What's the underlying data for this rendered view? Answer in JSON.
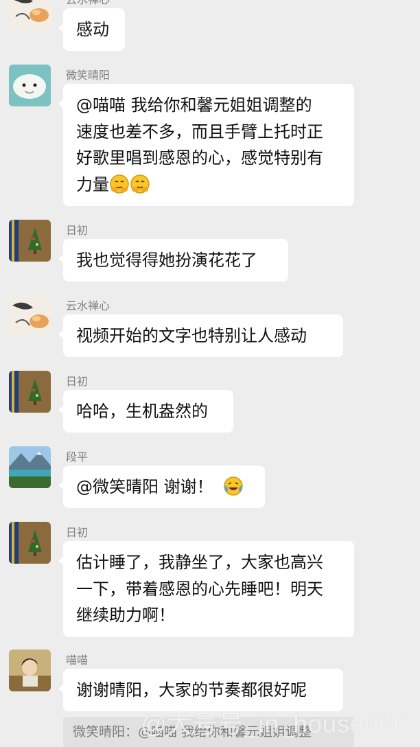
{
  "messages": [
    {
      "sender": "云水禅心",
      "avatar": "ink-painting-avatar",
      "text": "感动"
    },
    {
      "sender": "微笑晴阳",
      "avatar": "beluga-whale-avatar",
      "lines": [
        "@喵喵  我给你和馨元姐姐调整的",
        "速度也差不多，而且手臂上托时正",
        "好歌里唱到感恩的心，感觉特别有",
        "力量"
      ],
      "emoji": [
        "hugging-face-emoji",
        "hugging-face-emoji"
      ]
    },
    {
      "sender": "日初",
      "avatar": "christmas-tree-bag-avatar",
      "text": "我也觉得得她扮演花花了"
    },
    {
      "sender": "云水禅心",
      "avatar": "ink-painting-avatar",
      "text": "视频开始的文字也特别让人感动"
    },
    {
      "sender": "日初",
      "avatar": "christmas-tree-bag-avatar",
      "text": "哈哈，生机盎然的"
    },
    {
      "sender": "段平",
      "avatar": "mountain-lake-avatar",
      "text": "@微笑晴阳  谢谢！",
      "emoji": [
        "crying-laughing-emoji"
      ]
    },
    {
      "sender": "日初",
      "avatar": "christmas-tree-bag-avatar",
      "lines": [
        "估计睡了，我静坐了，大家也高兴",
        "一下，带着感恩的心先睡吧！明天",
        "继续助力啊！"
      ]
    },
    {
      "sender": "喵喵",
      "avatar": "girl-portrait-avatar",
      "text": "谢谢晴阳，大家的节奏都很好呢"
    }
  ],
  "quote": {
    "text": "微笑晴阳：@喵喵 我给你和馨元姐姐调整"
  },
  "watermark": {
    "text": "@大号号_in_house086"
  },
  "colors": {
    "background": "#ededed",
    "bubble": "#ffffff",
    "name": "#7f7f7f",
    "quote_bg": "#e1e1e1"
  }
}
